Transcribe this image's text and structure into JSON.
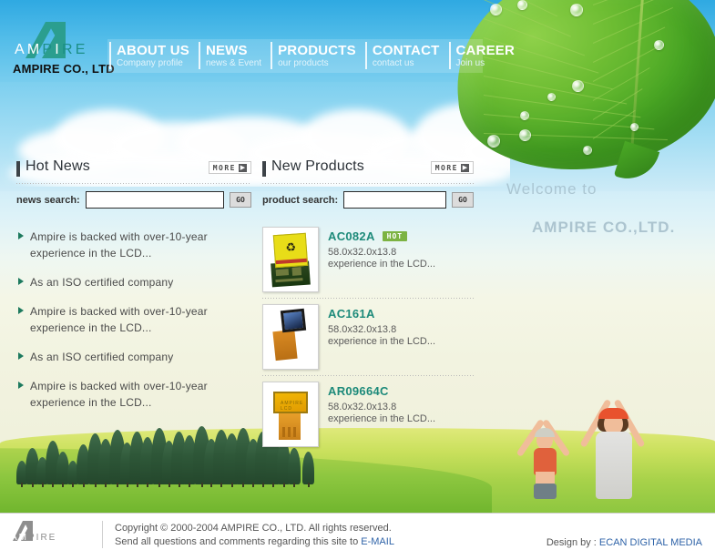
{
  "site": {
    "logo_word": "AMPIRE",
    "logo_sub": "AMPIRE CO., LTD",
    "watermark_line1": "Welcome to",
    "watermark_line2": "AMPIRE CO.,LTD."
  },
  "nav": {
    "items": [
      {
        "title": "ABOUT US",
        "subtitle": "Company profile"
      },
      {
        "title": "NEWS",
        "subtitle": "news & Event"
      },
      {
        "title": "PRODUCTS",
        "subtitle": "our products"
      },
      {
        "title": "CONTACT",
        "subtitle": "contact us"
      },
      {
        "title": "CAREER",
        "subtitle": "Join us"
      }
    ]
  },
  "news_panel": {
    "title": "Hot News",
    "more_label": "MORE",
    "more_arrow": "▶",
    "search_label": "news search:",
    "search_value": "",
    "search_placeholder": "",
    "go_label": "GO",
    "items": [
      {
        "text": "Ampire is backed with over-10-year experience in the LCD..."
      },
      {
        "text": "As an ISO certified company"
      },
      {
        "text": "Ampire is backed with over-10-year experience in the LCD..."
      },
      {
        "text": "As an ISO certified company"
      },
      {
        "text": "Ampire is backed with over-10-year experience in the LCD..."
      }
    ]
  },
  "products_panel": {
    "title": "New Products",
    "more_label": "MORE",
    "more_arrow": "▶",
    "search_label": "product search:",
    "search_value": "",
    "search_placeholder": "",
    "go_label": "GO",
    "items": [
      {
        "name": "AC082A",
        "badge": "HOT",
        "dimensions": "58.0x32.0x13.8",
        "description": "experience in the LCD...",
        "thumb_icon": "lcd-module-yellow-recycle"
      },
      {
        "name": "AC161A",
        "badge": "",
        "dimensions": "58.0x32.0x13.8",
        "description": "experience in the LCD...",
        "thumb_icon": "lcd-module-blue-screen"
      },
      {
        "name": "AR09664C",
        "badge": "",
        "dimensions": "58.0x32.0x13.8",
        "description": "experience in the LCD...",
        "thumb_icon": "lcd-module-orange-screen"
      }
    ]
  },
  "footer": {
    "logo_word": "AMPIRE",
    "copyright": "Copyright © 2000-2004 AMPIRE CO., LTD. All rights reserved.",
    "contact_prefix": "Send all questions and comments regarding this site to ",
    "contact_link": "E-MAIL",
    "design_prefix": "Design by : ",
    "design_link": "ECAN DIGITAL MEDIA"
  },
  "theme": {
    "sky_blue": "#3fb6e8",
    "leaf_green": "#6ebd33",
    "ground_green": "#8cc63f",
    "accent_teal": "#1d8a7a",
    "hot_badge_green": "#7cb342",
    "link_blue": "#2f63a8",
    "cream": "#f0f1dc"
  }
}
